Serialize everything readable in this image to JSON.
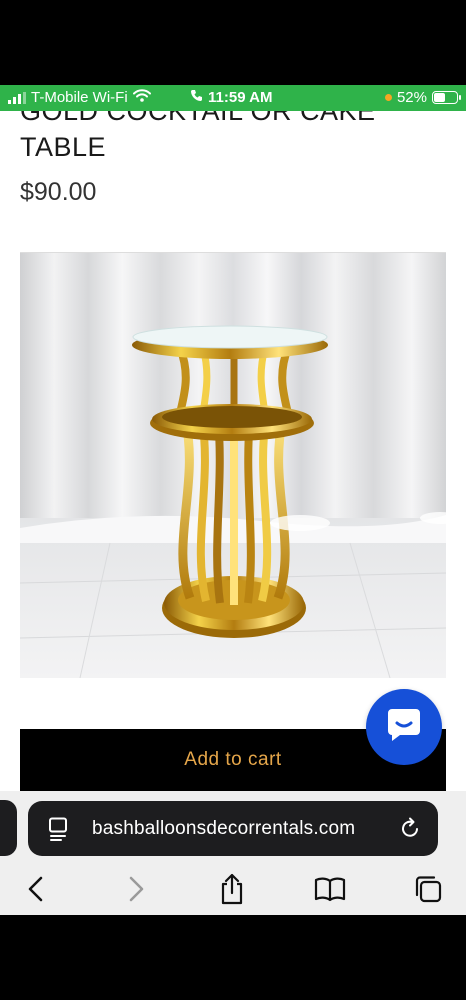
{
  "status_bar": {
    "carrier": "T-Mobile Wi-Fi",
    "time": "11:59 AM",
    "battery": "52%",
    "battery_level": 0.52,
    "background": "#2fb34a"
  },
  "product": {
    "title_partial": "GOLD COCKTAIL OR CAKE",
    "title": "TABLE",
    "price": "$90.00",
    "image": "gold-cocktail-table-photo",
    "add_to_cart_label": "Add to cart",
    "button_text_color": "#e5a64a"
  },
  "chat": {
    "icon": "chat-bubble-icon",
    "color": "#1650d8"
  },
  "browser": {
    "url": "bashballoonsdecorrentals.com",
    "page_icon": "page-format-icon",
    "reload_icon": "reload-icon",
    "toolbar": [
      "back-icon",
      "forward-icon",
      "share-icon",
      "bookmarks-icon",
      "tabs-icon"
    ]
  }
}
